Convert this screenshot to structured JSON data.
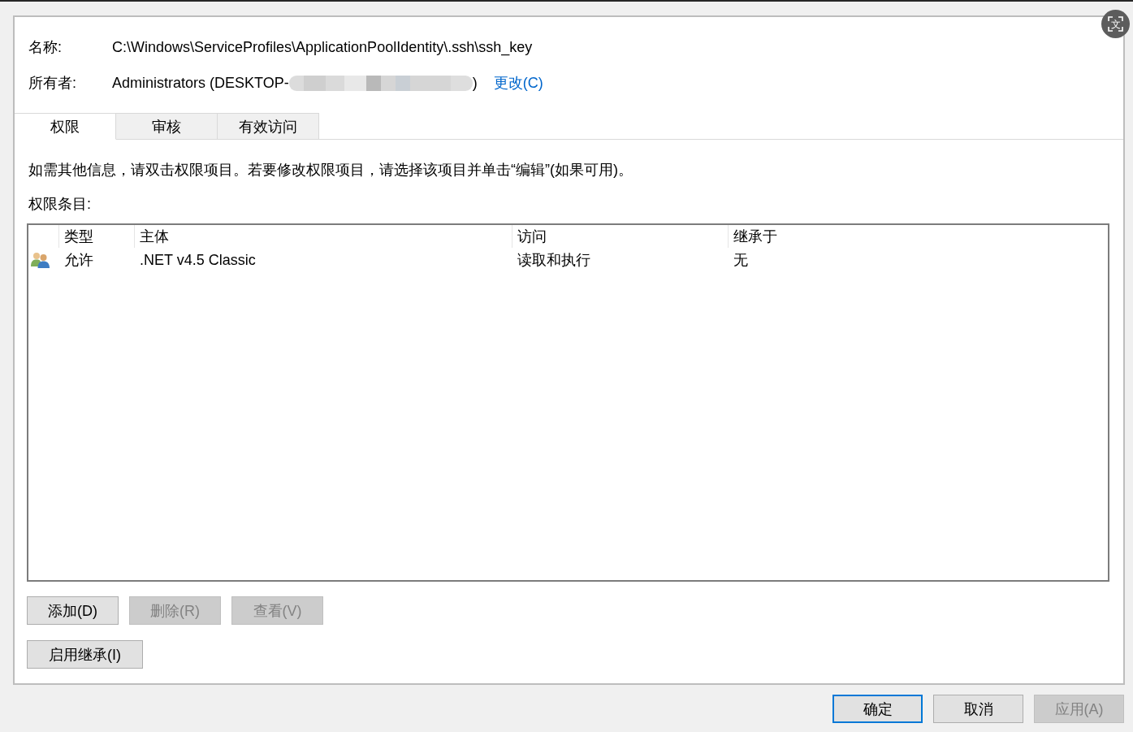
{
  "overlay_button": {
    "glyph": "文"
  },
  "properties": {
    "name_label": "名称:",
    "name_value": "C:\\Windows\\ServiceProfiles\\ApplicationPoolIdentity\\.ssh\\ssh_key",
    "owner_label": "所有者:",
    "owner_value_start": "Administrators (DESKTOP-",
    "owner_value_end": ")",
    "change_link": "更改(C)"
  },
  "tabs": [
    {
      "label": "权限",
      "selected": true
    },
    {
      "label": "审核",
      "selected": false
    },
    {
      "label": "有效访问",
      "selected": false
    }
  ],
  "description": "如需其他信息，请双击权限项目。若要修改权限项目，请选择该项目并单击“编辑”(如果可用)。",
  "entries_label": "权限条目:",
  "table": {
    "columns": [
      "类型",
      "主体",
      "访问",
      "继承于"
    ],
    "rows": [
      {
        "selected": false,
        "cells": [
          "允许",
          ".NET v4.5 Classic",
          "读取和执行",
          "无"
        ]
      }
    ]
  },
  "actions": [
    {
      "label": "添加(D)",
      "disabled": false
    },
    {
      "label": "删除(R)",
      "disabled": true
    },
    {
      "label": "查看(V)",
      "disabled": true
    }
  ],
  "inheritance_button": {
    "label": "启用继承(I)",
    "disabled": false
  },
  "dialog_buttons": [
    {
      "label": "确定",
      "disabled": false,
      "focused": true
    },
    {
      "label": "取消",
      "disabled": false,
      "focused": false
    },
    {
      "label": "应用(A)",
      "disabled": true,
      "focused": false
    }
  ]
}
